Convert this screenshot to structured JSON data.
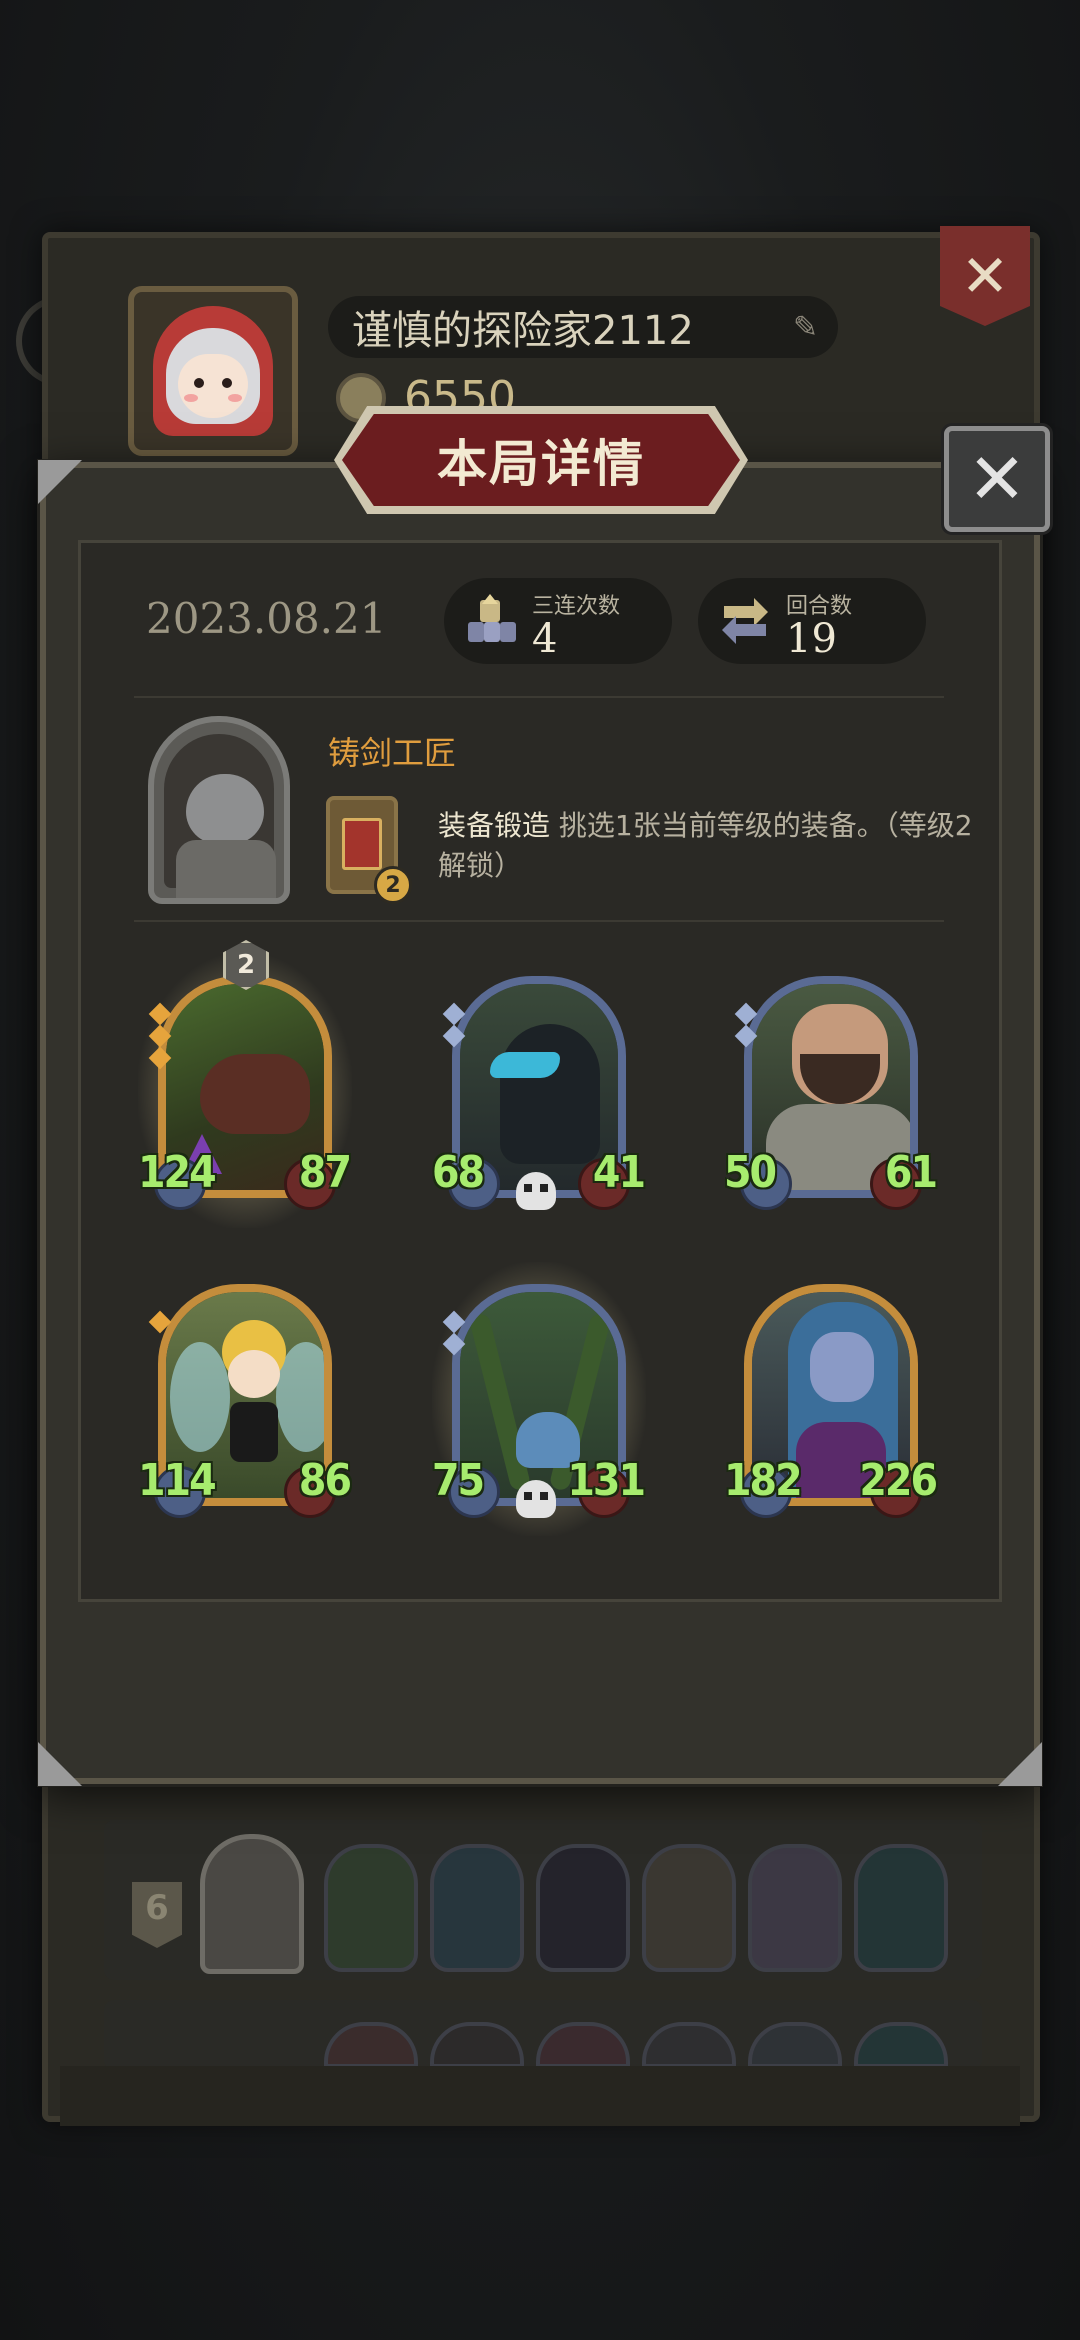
{
  "profile": {
    "name": "谨慎的探险家2112",
    "coins": "6550"
  },
  "modal": {
    "title": "本局详情",
    "date": "2023.08.21",
    "stats": [
      {
        "label": "三连次数",
        "value": "4",
        "icon": "triple-stack-icon"
      },
      {
        "label": "回合数",
        "value": "19",
        "icon": "cycle-arrows-icon"
      }
    ],
    "hero": {
      "name": "铸剑工匠",
      "skill_name": "装备锻造",
      "skill_desc": " 挑选1张当前等级的装备。（等级2解锁）",
      "skill_level": "2"
    },
    "units": [
      {
        "attack": "124",
        "health": "87",
        "stars": 3,
        "level_badge": "2",
        "frame": "gold",
        "art": "boar",
        "glow": true,
        "skull": false
      },
      {
        "attack": "68",
        "health": "41",
        "stars": 2,
        "level_badge": "",
        "frame": "blue",
        "art": "raven",
        "glow": false,
        "skull": true
      },
      {
        "attack": "50",
        "health": "61",
        "stars": 2,
        "level_badge": "",
        "frame": "blue",
        "art": "warrior",
        "glow": false,
        "skull": false
      },
      {
        "attack": "114",
        "health": "86",
        "stars": 1,
        "level_badge": "",
        "frame": "gold",
        "art": "fairy",
        "glow": false,
        "skull": false
      },
      {
        "attack": "75",
        "health": "131",
        "stars": 2,
        "level_badge": "",
        "frame": "blue",
        "art": "vine",
        "glow": true,
        "skull": true
      },
      {
        "attack": "182",
        "health": "226",
        "stars": 0,
        "level_badge": "",
        "frame": "gold",
        "art": "elf",
        "glow": false,
        "skull": false
      }
    ]
  },
  "history": {
    "rank": "6"
  },
  "colors": {
    "accent_orange": "#e09d3e",
    "stat_green": "#a7ec6e",
    "title_red": "#6b1d1f"
  }
}
